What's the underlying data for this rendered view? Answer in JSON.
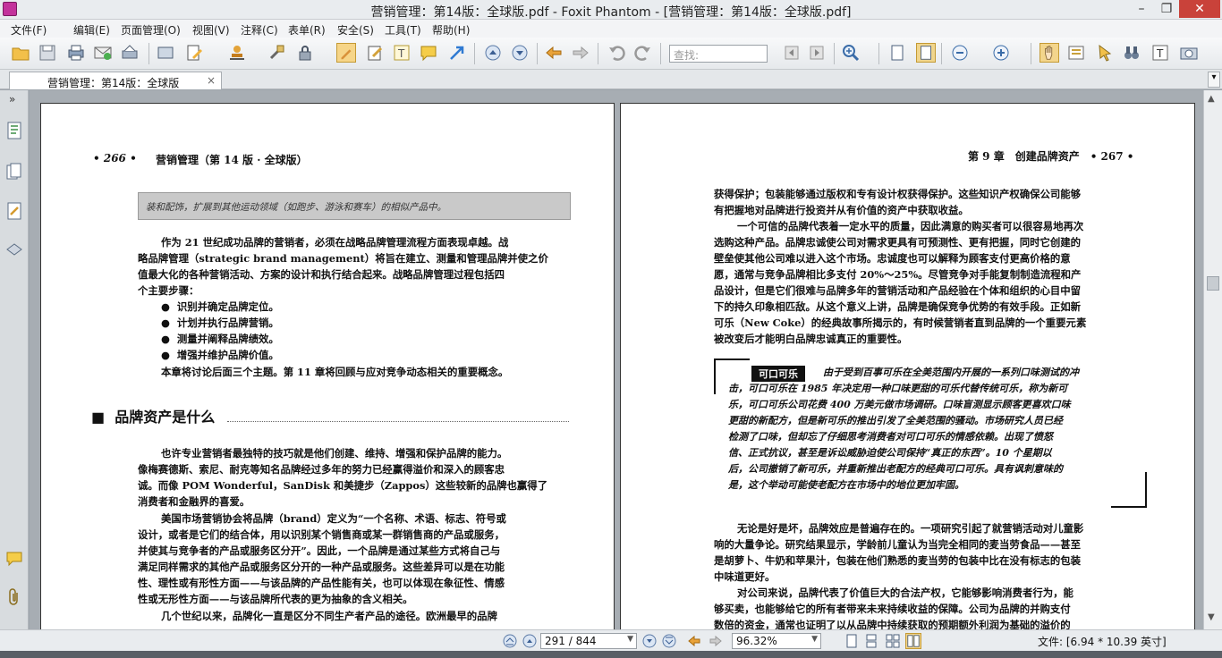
{
  "window": {
    "title": "营销管理：第14版：全球版.pdf - Foxit Phantom - [营销管理：第14版：全球版.pdf]",
    "min": "–",
    "max": "❐",
    "close": "✕"
  },
  "menu": [
    "文件(F)",
    "编辑(E)",
    "页面管理(O)",
    "视图(V)",
    "注释(C)",
    "表单(R)",
    "安全(S)",
    "工具(T)",
    "帮助(H)"
  ],
  "toolbar": {
    "search_placeholder": "查找:"
  },
  "tab": {
    "label": "营销管理：第14版：全球版",
    "close": "×",
    "list": "▾"
  },
  "sidebar": {
    "collapse": "»"
  },
  "left_page": {
    "header_num": "• 266 •",
    "header_title": "营销管理（第 14 版 · 全球版）",
    "tip": "装和配饰，扩展到其他运动领域（如跑步、游泳和赛车）的相似产品中。",
    "para1": [
      "作为 21 世纪成功品牌的营销者，必须在战略品牌管理流程方面表现卓越。战",
      "略品牌管理（strategic brand management）将旨在建立、测量和管理品牌并使之价",
      "值最大化的各种营销活动、方案的设计和执行结合起来。战略品牌管理过程包括四",
      "个主要步骤："
    ],
    "bullets": [
      "识别并确定品牌定位。",
      "计划并执行品牌营销。",
      "测量并阐释品牌绩效。",
      "增强并维护品牌价值。"
    ],
    "para2": "本章将讨论后面三个主题。第 11 章将回顾与应对竞争动态相关的重要概念。",
    "section_title": "品牌资产是什么",
    "para3": [
      "也许专业营销者最独特的技巧就是他们创建、维持、增强和保护品牌的能力。",
      "像梅赛德斯、索尼、耐克等知名品牌经过多年的努力已经赢得溢价和深入的顾客忠",
      "诚。而像 POM Wonderful，SanDisk 和美捷步（Zappos）这些较新的品牌也赢得了",
      "消费者和金融界的喜爱。"
    ],
    "para4": [
      "美国市场营销协会将品牌（brand）定义为“一个名称、术语、标志、符号或",
      "设计，或者是它们的结合体，用以识别某个销售商或某一群销售商的产品或服务，",
      "并使其与竞争者的产品或服务区分开”。因此，一个品牌是通过某些方式将自己与",
      "满足同样需求的其他产品或服务区分开的一种产品或服务。这些差异可以是在功能",
      "性、理性或有形性方面——与该品牌的产品性能有关，也可以体现在象征性、情感",
      "性或无形性方面——与该品牌所代表的更为抽象的含义相关。"
    ],
    "para5": "几个世纪以来，品牌化一直是区分不同生产者产品的途径。欧洲最早的品牌"
  },
  "right_page": {
    "header_title": "第 9 章　创建品牌资产　• 267 •",
    "para1": [
      "获得保护；包装能够通过版权和专有设计权获得保护。这些知识产权确保公司能够",
      "有把握地对品牌进行投资并从有价值的资产中获取收益。"
    ],
    "para2": [
      "一个可信的品牌代表着一定水平的质量，因此满意的购买者可以很容易地再次",
      "选购这种产品。品牌忠诚使公司对需求更具有可预测性、更有把握，同时它创建的",
      "壁垒使其他公司难以进入这个市场。忠诚度也可以解释为顾客支付更高价格的意",
      "愿，通常与竞争品牌相比多支付 20%～25%。尽管竞争对手能复制制造流程和产",
      "品设计，但是它们很难与品牌多年的营销活动和产品经验在个体和组织的心目中留",
      "下的持久印象相匹敌。从这个意义上讲，品牌是确保竞争优势的有效手段。正如新",
      "可乐（New Coke）的经典故事所揭示的，有时候营销者直到品牌的一个重要元素",
      "被改变后才能明白品牌忠诚真正的重要性。"
    ],
    "case_label": "可口可乐",
    "case_first": "由于受到百事可乐在全美范围内开展的一系列口味测试的冲",
    "case_lines": [
      "击，可口可乐在 1985 年决定用一种口味更甜的可乐代替传统可乐，称为新可",
      "乐，可口可乐公司花费 400 万美元做市场调研。口味盲测显示顾客更喜欢口味",
      "更甜的新配方，但是新可乐的推出引发了全美范围的骚动。市场研究人员已经",
      "检测了口味，但却忘了仔细思考消费者对可口可乐的情感依赖。出现了愤怒",
      "信、正式抗议，甚至是诉讼威胁迫使公司保持“真正的东西”。10 个星期以",
      "后，公司撤销了新可乐，并重新推出老配方的经典可口可乐。具有讽刺意味的",
      "是，这个举动可能使老配方在市场中的地位更加牢固。"
    ],
    "para3": [
      "无论是好是坏，品牌效应是普遍存在的。一项研究引起了就营销活动对儿童影",
      "响的大量争论。研究结果显示，学龄前儿童认为当完全相同的麦当劳食品——甚至",
      "是胡萝卜、牛奶和苹果汁，包装在他们熟悉的麦当劳的包装中比在没有标志的包装",
      "中味道更好。"
    ],
    "para4": [
      "对公司来说，品牌代表了价值巨大的合法产权，它能够影响消费者行为，能",
      "够买卖，也能够给它的所有者带来未来持续收益的保障。公司为品牌的并购支付",
      "数倍的资金，通常也证明了以从品牌中持续获取的预期额外利润为基础的溢价的"
    ]
  },
  "status": {
    "page_display": "291 / 844",
    "zoom": "96.32%",
    "file_size": "文件: [6.94 * 10.39 英寸]"
  }
}
